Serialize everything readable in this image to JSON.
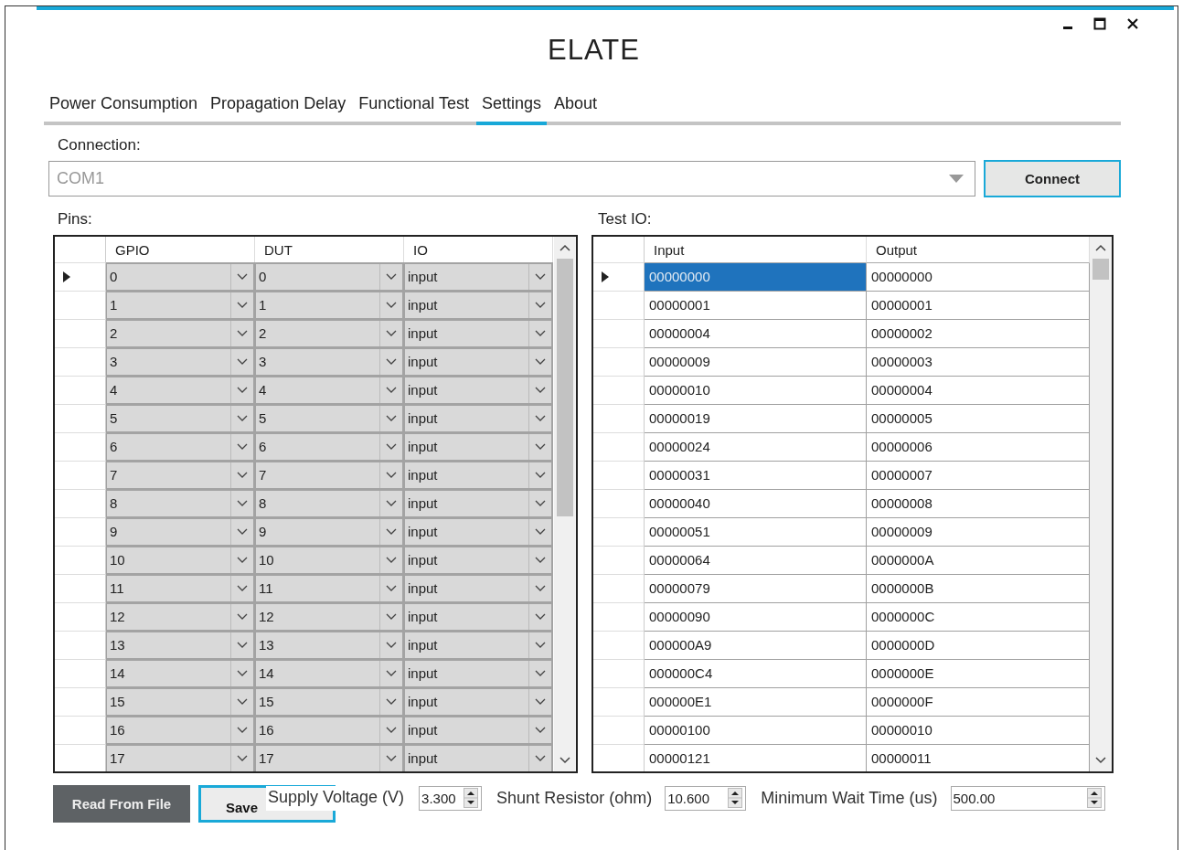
{
  "window": {
    "title": "ELATE"
  },
  "tabs": [
    {
      "label": "Power Consumption",
      "selected": false
    },
    {
      "label": "Propagation Delay",
      "selected": false
    },
    {
      "label": "Functional Test",
      "selected": false
    },
    {
      "label": "Settings",
      "selected": true
    },
    {
      "label": "About",
      "selected": false
    }
  ],
  "connection": {
    "label": "Connection:",
    "value": "COM1",
    "button": "Connect"
  },
  "pins": {
    "label": "Pins:",
    "columns": [
      "GPIO",
      "DUT",
      "IO"
    ],
    "rows": [
      {
        "gpio": "0",
        "dut": "0",
        "io": "input",
        "current": true
      },
      {
        "gpio": "1",
        "dut": "1",
        "io": "input",
        "current": false
      },
      {
        "gpio": "2",
        "dut": "2",
        "io": "input",
        "current": false
      },
      {
        "gpio": "3",
        "dut": "3",
        "io": "input",
        "current": false
      },
      {
        "gpio": "4",
        "dut": "4",
        "io": "input",
        "current": false
      },
      {
        "gpio": "5",
        "dut": "5",
        "io": "input",
        "current": false
      },
      {
        "gpio": "6",
        "dut": "6",
        "io": "input",
        "current": false
      },
      {
        "gpio": "7",
        "dut": "7",
        "io": "input",
        "current": false
      },
      {
        "gpio": "8",
        "dut": "8",
        "io": "input",
        "current": false
      },
      {
        "gpio": "9",
        "dut": "9",
        "io": "input",
        "current": false
      },
      {
        "gpio": "10",
        "dut": "10",
        "io": "input",
        "current": false
      },
      {
        "gpio": "11",
        "dut": "11",
        "io": "input",
        "current": false
      },
      {
        "gpio": "12",
        "dut": "12",
        "io": "input",
        "current": false
      },
      {
        "gpio": "13",
        "dut": "13",
        "io": "input",
        "current": false
      },
      {
        "gpio": "14",
        "dut": "14",
        "io": "input",
        "current": false
      },
      {
        "gpio": "15",
        "dut": "15",
        "io": "input",
        "current": false
      },
      {
        "gpio": "16",
        "dut": "16",
        "io": "input",
        "current": false
      },
      {
        "gpio": "17",
        "dut": "17",
        "io": "input",
        "current": false
      }
    ]
  },
  "test_io": {
    "label": "Test IO:",
    "columns": [
      "Input",
      "Output"
    ],
    "rows": [
      {
        "input": "00000000",
        "output": "00000000",
        "current": true,
        "selected": true
      },
      {
        "input": "00000001",
        "output": "00000001",
        "current": false,
        "selected": false
      },
      {
        "input": "00000004",
        "output": "00000002",
        "current": false,
        "selected": false
      },
      {
        "input": "00000009",
        "output": "00000003",
        "current": false,
        "selected": false
      },
      {
        "input": "00000010",
        "output": "00000004",
        "current": false,
        "selected": false
      },
      {
        "input": "00000019",
        "output": "00000005",
        "current": false,
        "selected": false
      },
      {
        "input": "00000024",
        "output": "00000006",
        "current": false,
        "selected": false
      },
      {
        "input": "00000031",
        "output": "00000007",
        "current": false,
        "selected": false
      },
      {
        "input": "00000040",
        "output": "00000008",
        "current": false,
        "selected": false
      },
      {
        "input": "00000051",
        "output": "00000009",
        "current": false,
        "selected": false
      },
      {
        "input": "00000064",
        "output": "0000000A",
        "current": false,
        "selected": false
      },
      {
        "input": "00000079",
        "output": "0000000B",
        "current": false,
        "selected": false
      },
      {
        "input": "00000090",
        "output": "0000000C",
        "current": false,
        "selected": false
      },
      {
        "input": "000000A9",
        "output": "0000000D",
        "current": false,
        "selected": false
      },
      {
        "input": "000000C4",
        "output": "0000000E",
        "current": false,
        "selected": false
      },
      {
        "input": "000000E1",
        "output": "0000000F",
        "current": false,
        "selected": false
      },
      {
        "input": "00000100",
        "output": "00000010",
        "current": false,
        "selected": false
      },
      {
        "input": "00000121",
        "output": "00000011",
        "current": false,
        "selected": false
      }
    ]
  },
  "buttons": [
    {
      "label": "Read From File",
      "kind": "dark"
    },
    {
      "label": "Save",
      "kind": "outlined"
    }
  ],
  "settings": [
    {
      "label": "Supply Voltage (V)",
      "value": "3.300"
    },
    {
      "label": "Shunt Resistor (ohm)",
      "value": "10.600"
    },
    {
      "label": "Minimum Wait Time (us)",
      "value": "500.00"
    }
  ]
}
